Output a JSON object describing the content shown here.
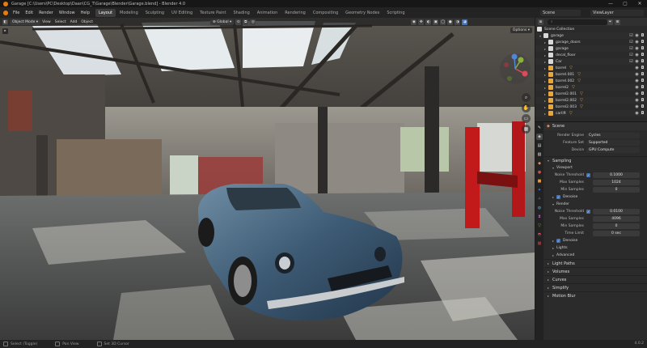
{
  "window": {
    "title": "Garage [C:\\Users\\PC\\Desktop\\Daan\\CG_T\\Garage\\Blender\\Garage.blend] - Blender 4.0",
    "controls": [
      "—",
      "▢",
      "✕"
    ]
  },
  "menubar": {
    "menus": [
      "File",
      "Edit",
      "Render",
      "Window",
      "Help"
    ],
    "workspaces": [
      "Layout",
      "Modeling",
      "Sculpting",
      "UV Editing",
      "Texture Paint",
      "Shading",
      "Animation",
      "Rendering",
      "Compositing",
      "Geometry Nodes",
      "Scripting"
    ],
    "active_workspace": "Layout",
    "scene": "Scene",
    "view_layer": "ViewLayer"
  },
  "viewport": {
    "mode": "Object Mode",
    "menus": [
      "View",
      "Select",
      "Add",
      "Object"
    ],
    "transform_orientation": "Global",
    "options": "Options"
  },
  "outliner": {
    "search_placeholder": "",
    "items": [
      {
        "name": "Scene Collection",
        "kind": "scene"
      },
      {
        "name": "garage",
        "kind": "collection"
      },
      {
        "name": "garage_doors",
        "kind": "collection"
      },
      {
        "name": "garage",
        "kind": "collection"
      },
      {
        "name": "decal_floor",
        "kind": "collection"
      },
      {
        "name": "Car",
        "kind": "collection"
      },
      {
        "name": "barrel",
        "kind": "mesh"
      },
      {
        "name": "barrel.001",
        "kind": "mesh"
      },
      {
        "name": "barrel.002",
        "kind": "mesh"
      },
      {
        "name": "barrel2",
        "kind": "mesh"
      },
      {
        "name": "barrel2.001",
        "kind": "mesh"
      },
      {
        "name": "barrel2.002",
        "kind": "mesh"
      },
      {
        "name": "barrel2.003",
        "kind": "mesh"
      },
      {
        "name": "carlift",
        "kind": "mesh"
      }
    ]
  },
  "properties": {
    "header": "Scene",
    "render_engine_label": "Render Engine",
    "render_engine": "Cycles",
    "feature_set_label": "Feature Set",
    "feature_set": "Supported",
    "device_label": "Device",
    "device": "GPU Compute",
    "sampling": "Sampling",
    "viewport_section": "Viewport",
    "viewport_noise_label": "Noise Threshold",
    "viewport_noise": "0.1000",
    "viewport_max_label": "Max Samples",
    "viewport_max": "1024",
    "viewport_min_label": "Min Samples",
    "viewport_min": "0",
    "viewport_denoise": "Denoise",
    "render_section": "Render",
    "render_noise_label": "Noise Threshold",
    "render_noise": "0.0100",
    "render_max_label": "Max Samples",
    "render_max": "4096",
    "render_min_label": "Min Samples",
    "render_min": "0",
    "time_limit_label": "Time Limit",
    "time_limit": "0 sec",
    "render_denoise": "Denoise",
    "lights": "Lights",
    "advanced": "Advanced",
    "light_paths": "Light Paths",
    "volumes": "Volumes",
    "curves": "Curves",
    "simplify": "Simplify",
    "motion_blur": "Motion Blur"
  },
  "statusbar": {
    "items": [
      "Select (Toggle)",
      "Pan View",
      "Set 3D Cursor"
    ],
    "version": "4.0.2"
  },
  "colors": {
    "accent": "#4772b3",
    "blender_orange": "#e87d0d",
    "car_body": "#3d5a74",
    "lift_red": "#c2191b"
  }
}
